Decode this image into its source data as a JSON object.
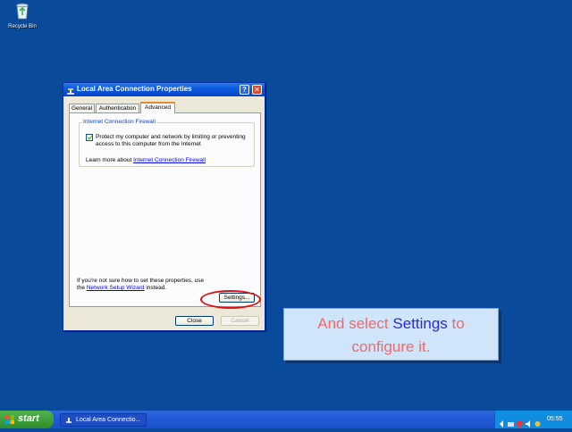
{
  "desktop": {
    "recycle_bin_label": "Recycle Bin"
  },
  "dialog": {
    "title": "Local Area Connection Properties",
    "help_icon": "?",
    "close_icon": "✕",
    "tabs": [
      {
        "label": "General"
      },
      {
        "label": "Authentication"
      },
      {
        "label": "Advanced"
      }
    ],
    "group_title": "Internet Connection Firewall",
    "checkbox_label": "Protect my computer and network by limiting or preventing access to this computer from the Internet",
    "learn_more_prefix": "Learn more about",
    "learn_more_link": "Internet Connection Firewall",
    "info_text": "If you're not sure how to set these properties, use the",
    "info_link": "Network Setup Wizard",
    "info_suffix": "instead.",
    "settings_button": "Settings...",
    "close_button": "Close",
    "cancel_button": "Cancel"
  },
  "caption": {
    "part1": "And select",
    "highlight": "Settings",
    "part2": "to configure it."
  },
  "taskbar": {
    "start_label": "start",
    "task_label": "Local Area Connectio...",
    "clock": "05:55"
  },
  "colors": {
    "desktop": "#0a4a9a",
    "title_bar": "#0a5adf",
    "caption_text": "#f06a6a",
    "caption_highlight": "#2a2ad0",
    "highlight_ring": "#e01010"
  }
}
